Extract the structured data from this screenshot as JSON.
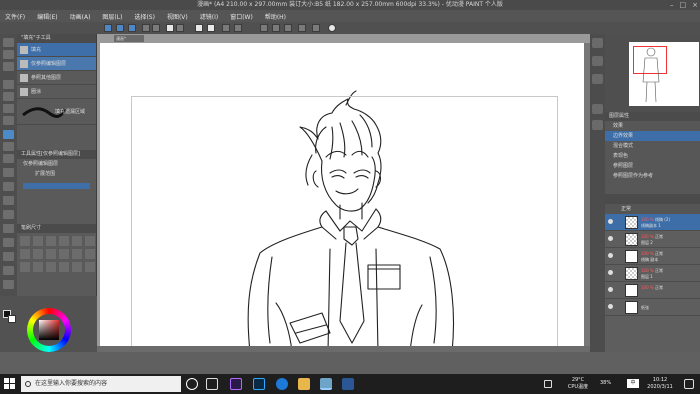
{
  "window": {
    "title": "漫画* (A4 210.00 x 297.00mm 装订大小:B5 纸 182.00 x 257.00mm 600dpi 33.3%) - 优动漫 PAINT 个人版"
  },
  "menu": [
    "文件(F)",
    "编辑(E)",
    "动画(A)",
    "图层(L)",
    "选择(S)",
    "视图(V)",
    "滤镜(I)",
    "窗口(W)",
    "帮助(H)"
  ],
  "canvas_tab": "漫画*",
  "subtool": {
    "header": "\"填充\"子工具",
    "items": [
      "填充",
      "仅参照编辑图层",
      "参照其他图层",
      "圈涂",
      "填充遗漏区域"
    ]
  },
  "properties": {
    "header": "工具属性[仅参照编辑图层]",
    "rows": [
      "仅参照编辑图层",
      "扩展范围"
    ]
  },
  "brush": {
    "header": "笔刷尺寸"
  },
  "layer_props": {
    "header": "图层属性",
    "rows": [
      "效果",
      "边界效果",
      "混合模式",
      "表现色",
      "参照图层",
      "参照图层作为参考"
    ]
  },
  "layers": {
    "mode": "正常",
    "items": [
      {
        "pct": "100 %",
        "name": "线稿 (2)",
        "sub": "线稿副本 1",
        "selected": true,
        "checker": true
      },
      {
        "pct": "100 %",
        "name": "正常",
        "sub": "图层 2",
        "selected": false,
        "checker": true
      },
      {
        "pct": "100 %",
        "name": "正常",
        "sub": "线稿 副本",
        "selected": false,
        "checker": false
      },
      {
        "pct": "100 %",
        "name": "正常",
        "sub": "图层 1",
        "selected": false,
        "checker": true
      },
      {
        "pct": "100 %",
        "name": "正常",
        "sub": "",
        "selected": false,
        "checker": false
      },
      {
        "pct": "",
        "name": "纸张",
        "sub": "",
        "selected": false,
        "checker": false
      }
    ]
  },
  "taskbar": {
    "search_placeholder": "在这里输入你要搜索的内容",
    "weather_temp": "29°C",
    "weather_desc": "CPU温度",
    "battery": "38%",
    "ime": "中",
    "time": "10:12",
    "date": "2020/3/11"
  }
}
